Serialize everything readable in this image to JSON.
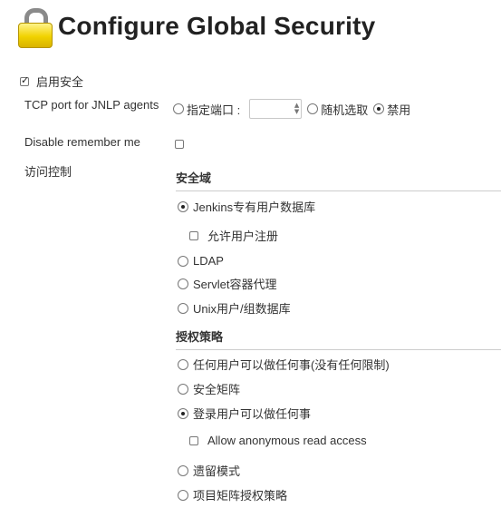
{
  "header": {
    "title": "Configure Global Security"
  },
  "enable_security": {
    "label": "启用安全",
    "checked": true
  },
  "jnlp": {
    "label": "TCP port for JNLP agents",
    "options": [
      "指定端口 :",
      "随机选取",
      "禁用"
    ],
    "selected": "禁用",
    "port_value": ""
  },
  "remember_me": {
    "label": "Disable remember me",
    "checked": false
  },
  "access_control": {
    "label": "访问控制",
    "realm": {
      "heading": "安全域",
      "options": [
        "Jenkins专有用户数据库",
        "LDAP",
        "Servlet容器代理",
        "Unix用户/组数据库"
      ],
      "selected": "Jenkins专有用户数据库",
      "allow_signup": {
        "label": "允许用户注册",
        "checked": false
      }
    },
    "authorization": {
      "heading": "授权策略",
      "options": [
        "任何用户可以做任何事(没有任何限制)",
        "安全矩阵",
        "登录用户可以做任何事",
        "遗留模式",
        "项目矩阵授权策略"
      ],
      "selected": "登录用户可以做任何事",
      "anonymous_read": {
        "label": "Allow anonymous read access",
        "checked": false
      }
    }
  }
}
